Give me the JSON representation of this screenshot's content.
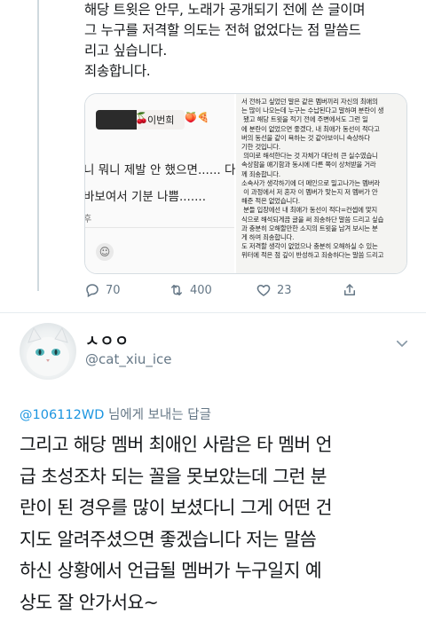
{
  "top_tweet": {
    "text_lines": [
      "해당 트윗은 안무, 노래가 공개되기 전에 쓴 글이며",
      "그 누구를 저격할 의도는 전혀 없었다는 점 말씀드",
      "리고 싶습니다.",
      "죄송합니다."
    ],
    "media": {
      "left_image": {
        "name_tag": "이번희",
        "line1": "니 뭐니 제발 안 했으면...... 다",
        "line2": "바보여서 기분 나쁨.......",
        "line3": "후"
      },
      "right_image_text": "서 전하고 싶었던 말은 같은 멤버끼리 자신의 최애의\n는 많이 나오는데 누구는 수납된다고 말하며 분란이 생\n 됐고 해당 트윗을 적기 전에 주변에서도 그런 일\n에 분란이 없었으면 좋겠다, 내 최애가 동선이 적다고\n버의 동선을 같이 욕하는 것 같아보이니 속상하다\n기한 것입니다.\n 의미로 해석한다는 것 자체가 대단히 큰 실수였습니\n속상함을 얘기함과 동시에 다른 쪽이 상처받을 거라\n께 죄송합니다.\n소속사가 생각하기에 더 메인으로 밀고나가는 멤버라\n 이 과정에서 저 혼자 이 멤버가 맞는지 저 멤버가 안\n해준 적은 없었습니다.\n 분들 입장에선 내 최애가 동선이 적다=컨셉에 맞지\n식으로 해석되게끔 글을 써 죄송하단 말씀 드리고 싶습\n과 충분히 오해할만한 소지의 트윗을 남겨 보시는 분\n게 하여 죄송합니다.\n도 저격할 생각이 없었으나 충분히 오해하실 수 있는\n위터에 적은 점 깊이 반성하고 죄송하다는 말씀 드리고"
    },
    "actions": {
      "reply_count": "70",
      "retweet_count": "400",
      "like_count": "23"
    }
  },
  "reply_tweet": {
    "display_name": "ㅅㅇㅇ",
    "handle": "@cat_xiu_ice",
    "replying_to_handle": "@106112WD",
    "replying_to_suffix": " 님에게 보내는 답글",
    "text_lines": [
      "그리고 해당 멤버 최애인 사람은 타 멤버 언",
      "급 초성조차 되는 꼴을 못보았는데 그런 분",
      "란이 된 경우를 많이 보셨다니 그게 어떤 건",
      "지도 알려주셨으면 좋겠습니다 저는 말씀",
      "하신 상황에서 언급될 멤버가 누구일지 예",
      "상도 잘 안가서요~"
    ]
  },
  "colors": {
    "secondary_text": "#657786",
    "link_blue": "#1b95e0",
    "divider": "#e6ecf0"
  },
  "icons": [
    "reply-icon",
    "retweet-icon",
    "like-icon",
    "share-icon",
    "chevron-down-icon",
    "emoji-icon"
  ]
}
